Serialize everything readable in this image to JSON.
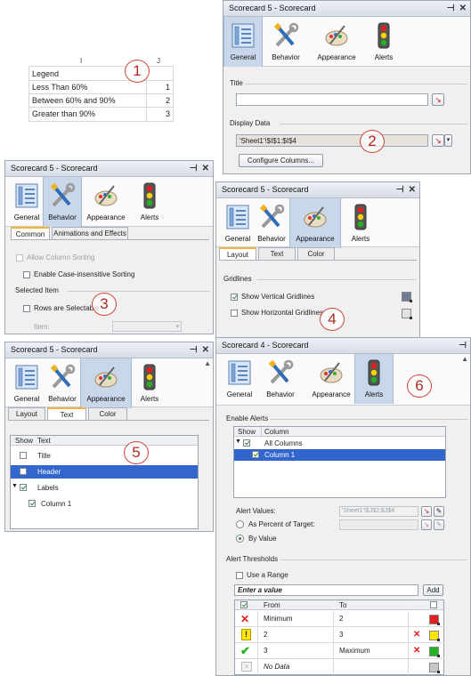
{
  "colors": {
    "accent": "#3366cc",
    "badge": "#d0443a",
    "tab_selected": "#c9d7ea"
  },
  "sheet": {
    "col_i": "I",
    "col_j": "J",
    "rows": [
      {
        "label": "Legend",
        "value": ""
      },
      {
        "label": "Less Than 60%",
        "value": "1"
      },
      {
        "label": "Between 60% and 90%",
        "value": "2"
      },
      {
        "label": "Greater than 90%",
        "value": "3"
      }
    ]
  },
  "badges": [
    "1",
    "2",
    "3",
    "4",
    "5",
    "6"
  ],
  "tabs": {
    "general": "General",
    "behavior": "Behavior",
    "appearance": "Appearance",
    "alerts": "Alerts"
  },
  "p1": {
    "title": "Scorecard 5 - Scorecard",
    "title_section": "Title",
    "display_section": "Display Data",
    "display_value": "'Sheet1'!$I$1:$I$4",
    "configure_button": "Configure Columns..."
  },
  "p2": {
    "title": "Scorecard 5 - Scorecard",
    "subtabs": [
      "Common",
      "Animations and Effects"
    ],
    "allow_sort": "Allow Column Sorting",
    "case_sort": "Enable Case-insensitive Sorting",
    "selected_item": "Selected Item",
    "rows_selectable": "Rows are Selectable",
    "item_label": "Item:"
  },
  "p3": {
    "title": "Scorecard 5 - Scorecard",
    "subtabs": [
      "Layout",
      "Text",
      "Color"
    ],
    "gridlines": "Gridlines",
    "vertical": "Show Vertical Gridlines",
    "horizontal": "Show Horizontal Gridlines"
  },
  "p4": {
    "title": "Scorecard 5 - Scorecard",
    "subtabs": [
      "Layout",
      "Text",
      "Color"
    ],
    "col_show": "Show",
    "col_text": "Text",
    "items": [
      "Title",
      "Header",
      "Labels",
      "Column 1"
    ]
  },
  "p5": {
    "title": "Scorecard 4 - Scorecard",
    "enable_alerts": "Enable Alerts",
    "col_show": "Show",
    "col_column": "Column",
    "all_columns": "All Columns",
    "column1": "Column 1",
    "alert_values": "Alert Values:",
    "alert_values_ref": "'Sheet1'!$J$2:$J$4",
    "as_percent": "As Percent of Target:",
    "by_value": "By Value",
    "thresholds": "Alert Thresholds",
    "use_range": "Use a Range",
    "enter_value": "Enter a value",
    "add": "Add",
    "th_from": "From",
    "th_to": "To",
    "rows": [
      {
        "from": "Minimum",
        "to": "2",
        "color": "#e02020",
        "icon": "red-x-icon"
      },
      {
        "from": "2",
        "to": "3",
        "color": "#ffe600",
        "icon": "yellow-exclamation-icon"
      },
      {
        "from": "3",
        "to": "Maximum",
        "color": "#22b422",
        "icon": "green-check-icon"
      },
      {
        "from": "No Data",
        "to": "",
        "color": "#c8c8c8",
        "icon": "no-data-icon"
      }
    ]
  }
}
